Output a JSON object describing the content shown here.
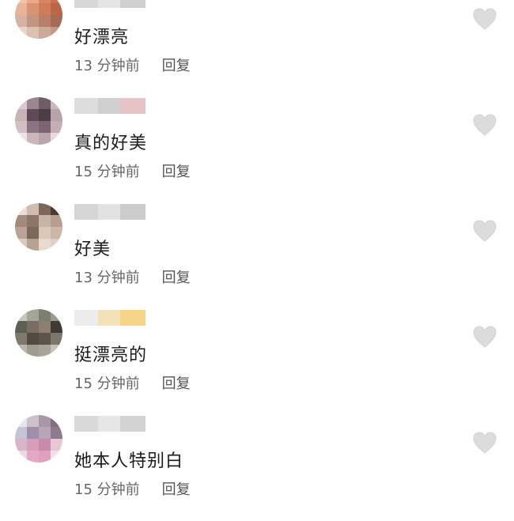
{
  "comments": [
    {
      "text": "好漂亮",
      "time": "13 分钟前",
      "reply_label": "回复",
      "like_icon": "heart-outline-icon",
      "avatar_colors": [
        "#f4c3a8",
        "#eda98a",
        "#d9855f",
        "#c9734e",
        "#e9b39a",
        "#d89274",
        "#cf7b57",
        "#b96744",
        "#d6b2a4",
        "#c3947f",
        "#b88069",
        "#a46c56",
        "#e8d4cc",
        "#dcc0b3",
        "#cda999",
        "#c49987"
      ],
      "name_colors": [
        "#d7d7d7",
        "#e4e4e4",
        "#cfcfcf"
      ]
    },
    {
      "text": "真的好美",
      "time": "15 分钟前",
      "reply_label": "回复",
      "like_icon": "heart-outline-icon",
      "avatar_colors": [
        "#d9c9cc",
        "#9c8790",
        "#6f5c66",
        "#cbb8bd",
        "#c8b3b9",
        "#5d4a55",
        "#4b3c46",
        "#b7a3a9",
        "#d1bfc3",
        "#8b7580",
        "#7a6570",
        "#c2aeb4",
        "#ece4e6",
        "#c9b7bc",
        "#b9a5ab",
        "#e6dcde"
      ],
      "name_colors": [
        "#dddddd",
        "#d0d0d0",
        "#e8c3c5"
      ]
    },
    {
      "text": "好美",
      "time": "13 分钟前",
      "reply_label": "回复",
      "like_icon": "heart-outline-icon",
      "avatar_colors": [
        "#e9ded5",
        "#cfbcb0",
        "#7d675a",
        "#4a3a31",
        "#a28b7c",
        "#8e7667",
        "#c9b3a3",
        "#b79f90",
        "#b8a396",
        "#7c6759",
        "#dcc7b9",
        "#cbb6a8",
        "#d9c9bf",
        "#b6a193",
        "#ead9ce",
        "#e0cfc4"
      ],
      "name_colors": [
        "#d5d5d5",
        "#e2e2e2",
        "#cccccc"
      ]
    },
    {
      "text": "挺漂亮的",
      "time": "15 分钟前",
      "reply_label": "回复",
      "like_icon": "heart-outline-icon",
      "avatar_colors": [
        "#c6c7b9",
        "#a4a697",
        "#7c7e70",
        "#9b9c8d",
        "#5e6053",
        "#7a6d62",
        "#8d7e72",
        "#3f3a34",
        "#7f7a6e",
        "#504a43",
        "#5d554d",
        "#7b776b",
        "#b9b7ab",
        "#9e9b8f",
        "#a8a498",
        "#c5c3b8"
      ],
      "name_colors": [
        "#ececec",
        "#f3e2b8",
        "#f6d488"
      ]
    },
    {
      "text": "她本人特别白",
      "time": "15 分钟前",
      "reply_label": "回复",
      "like_icon": "heart-outline-icon",
      "avatar_colors": [
        "#ece3ea",
        "#cfc1cc",
        "#a797a7",
        "#7f6f80",
        "#c7c3d6",
        "#9e90aa",
        "#b9a5b8",
        "#8e7b92",
        "#d9b5c9",
        "#d79eb9",
        "#c98aab",
        "#e7c7d6",
        "#f0d6e2",
        "#e3a9c3",
        "#dea0bd",
        "#f3e1ea"
      ],
      "name_colors": [
        "#d9d9d9",
        "#e6e6e6",
        "#d2d2d2"
      ]
    }
  ]
}
